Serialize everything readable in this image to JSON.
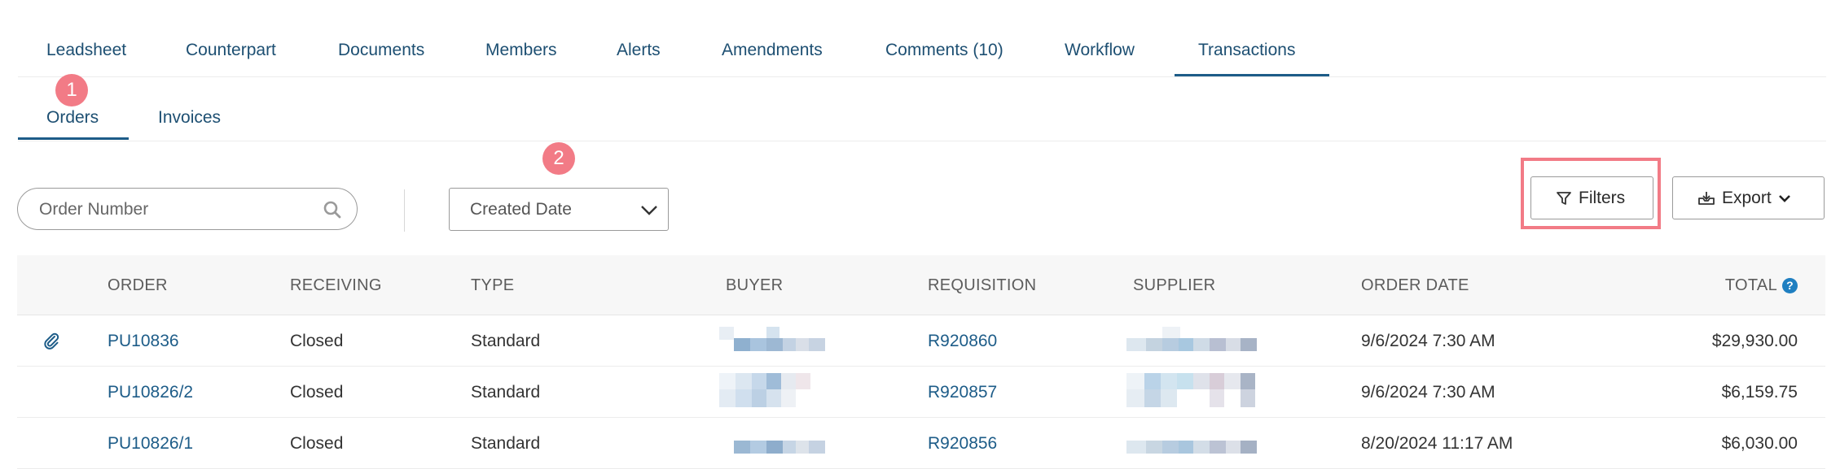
{
  "tabs": [
    {
      "label": "Leadsheet",
      "active": false
    },
    {
      "label": "Counterpart",
      "active": false
    },
    {
      "label": "Documents",
      "active": false
    },
    {
      "label": "Members",
      "active": false
    },
    {
      "label": "Alerts",
      "active": false
    },
    {
      "label": "Amendments",
      "active": false
    },
    {
      "label": "Comments (10)",
      "active": false
    },
    {
      "label": "Workflow",
      "active": false
    },
    {
      "label": "Transactions",
      "active": true
    }
  ],
  "subtabs": [
    {
      "label": "Orders",
      "active": true
    },
    {
      "label": "Invoices",
      "active": false
    }
  ],
  "badges": {
    "one": "1",
    "two": "2"
  },
  "search": {
    "placeholder": "Order Number",
    "icon": "search-icon"
  },
  "date_filter": {
    "selected": "Created Date",
    "icon": "chevron-down-icon"
  },
  "toolbar": {
    "filters_label": "Filters",
    "filters_icon": "funnel-icon",
    "export_label": "Export",
    "export_icon": "download-tray-icon"
  },
  "table": {
    "columns": [
      "",
      "ORDER",
      "RECEIVING",
      "TYPE",
      "BUYER",
      "REQUISITION",
      "SUPPLIER",
      "ORDER DATE",
      "TOTAL"
    ],
    "total_help_icon": "?",
    "rows": [
      {
        "attachment": true,
        "order": "PU10836",
        "receiving": "Closed",
        "type": "Standard",
        "requisition": "R920860",
        "order_date": "9/6/2024 7:30 AM",
        "total": "$29,930.00"
      },
      {
        "attachment": false,
        "order": "PU10826/2",
        "receiving": "Closed",
        "type": "Standard",
        "requisition": "R920857",
        "order_date": "9/6/2024 7:30 AM",
        "total": "$6,159.75"
      },
      {
        "attachment": false,
        "order": "PU10826/1",
        "receiving": "Closed",
        "type": "Standard",
        "requisition": "R920856",
        "order_date": "8/20/2024 11:17 AM",
        "total": "$6,030.00"
      }
    ]
  },
  "colors": {
    "link": "#1d5c88",
    "accent_badge": "#f27b86",
    "highlight_border": "#f27b86",
    "header_bg": "#f7f7f7",
    "help_icon": "#1f7fc1"
  }
}
